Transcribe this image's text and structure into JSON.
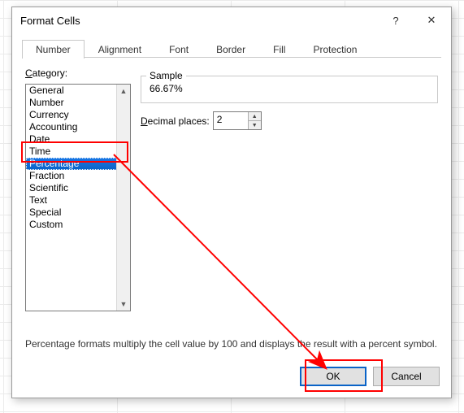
{
  "dialog": {
    "title": "Format Cells",
    "help_symbol": "?",
    "close_symbol": "✕"
  },
  "tabs": [
    {
      "label": "Number",
      "active": true
    },
    {
      "label": "Alignment",
      "active": false
    },
    {
      "label": "Font",
      "active": false
    },
    {
      "label": "Border",
      "active": false
    },
    {
      "label": "Fill",
      "active": false
    },
    {
      "label": "Protection",
      "active": false
    }
  ],
  "category": {
    "label_pre": "",
    "label_u": "C",
    "label_post": "ategory:",
    "items": [
      "General",
      "Number",
      "Currency",
      "Accounting",
      "Date",
      "Time",
      "Percentage",
      "Fraction",
      "Scientific",
      "Text",
      "Special",
      "Custom"
    ],
    "selected_index": 6
  },
  "sample": {
    "legend": "Sample",
    "value": "66.67%"
  },
  "decimal": {
    "label_u": "D",
    "label_post": "ecimal places:",
    "value": "2"
  },
  "description": "Percentage formats multiply the cell value by 100 and displays the result with a percent symbol.",
  "footer": {
    "ok": "OK",
    "cancel": "Cancel"
  }
}
